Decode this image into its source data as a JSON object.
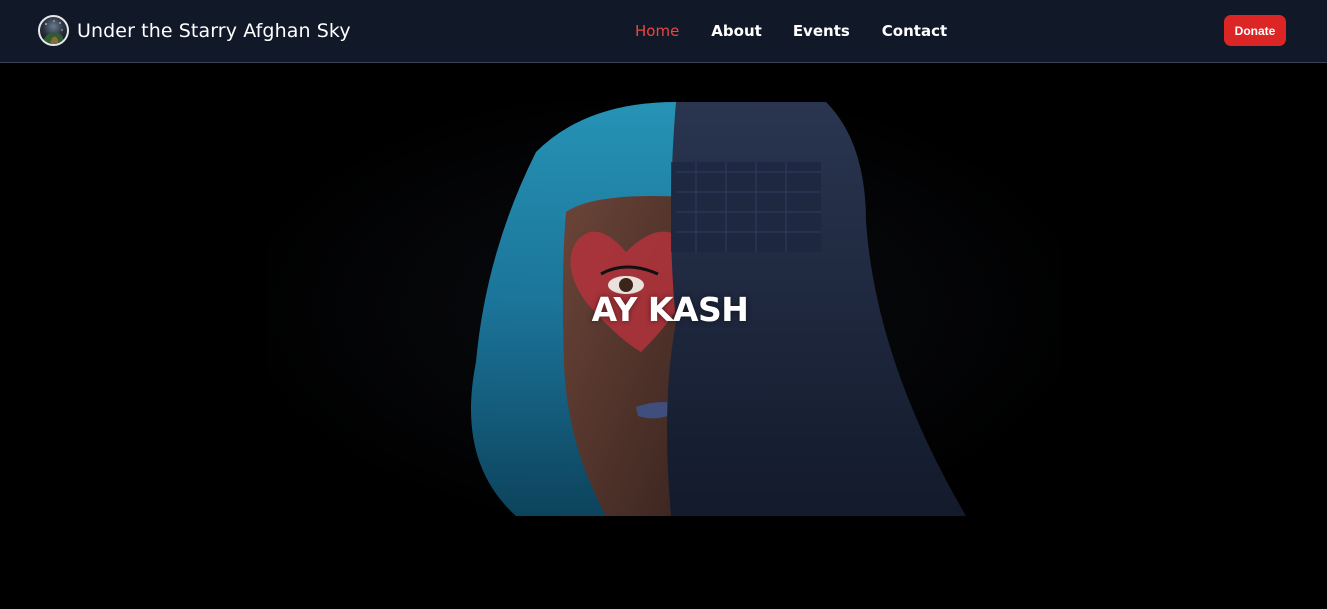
{
  "header": {
    "brand_title": "Under the Starry Afghan Sky",
    "logo_icon": "starry-sky-logo",
    "nav": [
      {
        "label": "Home",
        "active": true
      },
      {
        "label": "About",
        "active": false
      },
      {
        "label": "Events",
        "active": false
      },
      {
        "label": "Contact",
        "active": false
      }
    ],
    "donate_label": "Donate"
  },
  "hero": {
    "title": "AY KASH",
    "image_description_icon": "hero-portrait-image"
  },
  "colors": {
    "nav_background": "#111827",
    "accent_red": "#dc2626",
    "active_link": "#ef4444",
    "hero_background": "#000000"
  }
}
